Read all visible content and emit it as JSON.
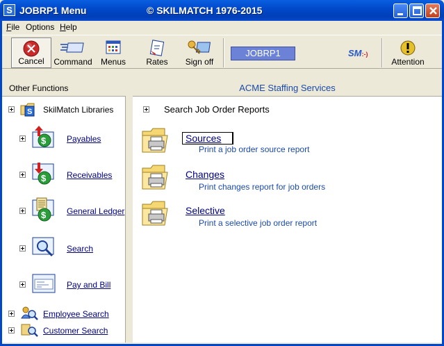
{
  "window": {
    "title": "JOBRP1 Menu",
    "copyright": "© SKILMATCH 1976-2015",
    "icon_letter": "S"
  },
  "menubar": {
    "items": [
      {
        "label": "ile",
        "accel": "F"
      },
      {
        "label": "Options"
      },
      {
        "label": "elp",
        "accel": "H"
      }
    ]
  },
  "toolbar": {
    "cancel": "Cancel",
    "command": "Command",
    "menus": "Menus",
    "rates": "Rates",
    "signoff": "Sign off",
    "job_id": "JOBRP1",
    "logo": "SM",
    "logo_mark": ":-)",
    "attention": "Attention"
  },
  "left": {
    "header": "Other Functions",
    "items": [
      {
        "label": "SkilMatch Libraries",
        "icon": "library-folder-icon"
      },
      {
        "label": "Payables",
        "icon": "money-up-icon"
      },
      {
        "label": "Receivables",
        "icon": "money-down-icon"
      },
      {
        "label": "General Ledger",
        "icon": "ledger-icon"
      },
      {
        "label": "Search",
        "icon": "magnifier-icon"
      },
      {
        "label": "Pay and Bill",
        "icon": "paybill-icon"
      },
      {
        "label": "Employee Search",
        "icon": "people-search-icon"
      },
      {
        "label": "Customer Search",
        "icon": "customer-search-icon"
      }
    ]
  },
  "right": {
    "header": "ACME Staffing Services",
    "group_title": "Search Job Order Reports",
    "reports": [
      {
        "label": "Sources",
        "desc": "Print a job order source report"
      },
      {
        "label": "Changes",
        "desc": "Print changes report for job orders"
      },
      {
        "label": "Selective",
        "desc": "Print a selective job order report"
      }
    ]
  },
  "colors": {
    "titlebar": "#0047c9",
    "link": "#00007f",
    "accent_text": "#1a4aa8",
    "job_box": "#6b82d6"
  }
}
